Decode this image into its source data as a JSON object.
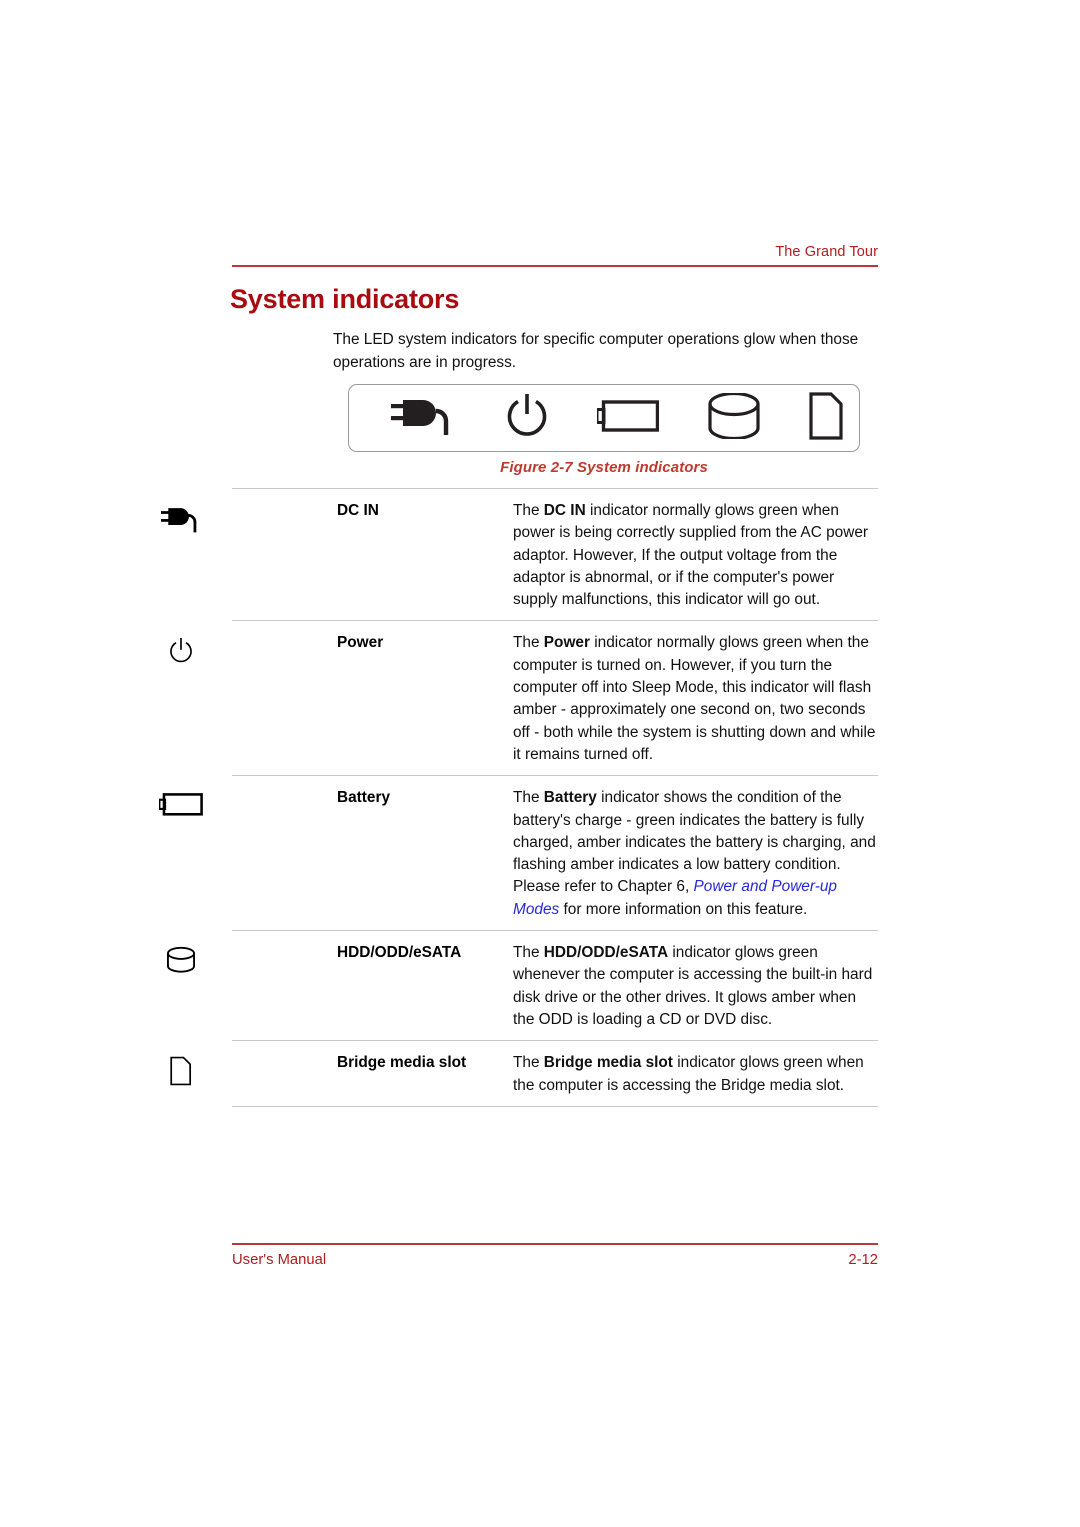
{
  "header": {
    "running_head": "The Grand Tour"
  },
  "section": {
    "title": "System indicators",
    "intro": "The LED system indicators for specific computer operations glow when those operations are in progress."
  },
  "figure": {
    "caption": "Figure 2-7 System indicators",
    "icons": [
      "dc-in-plug-icon",
      "power-button-icon",
      "battery-icon",
      "hdd-cylinder-icon",
      "bridge-media-card-icon"
    ]
  },
  "indicators": [
    {
      "icon": "dc-in-plug-icon",
      "name": "DC IN",
      "desc_prefix": "The ",
      "desc_bold": "DC IN",
      "desc_suffix": " indicator normally glows green when power is being correctly supplied from the AC power adaptor. However, If the output voltage from the adaptor is abnormal, or if the computer's power supply malfunctions, this indicator will go out."
    },
    {
      "icon": "power-button-icon",
      "name": "Power",
      "desc_prefix": "The ",
      "desc_bold": "Power",
      "desc_suffix": " indicator normally glows green when the computer is turned on. However, if you turn the computer off into Sleep Mode, this indicator will flash amber - approximately one second on, two seconds off - both while the system is shutting down and while it remains turned off."
    },
    {
      "icon": "battery-icon",
      "name": "Battery",
      "desc_prefix": "The ",
      "desc_bold": "Battery",
      "desc_mid": " indicator shows the condition of the battery's charge - green indicates the battery is fully charged, amber indicates the battery is charging, and flashing amber indicates a low battery condition. Please refer to Chapter 6, ",
      "desc_link": "Power and Power-up Modes",
      "desc_suffix": " for more information on this feature."
    },
    {
      "icon": "hdd-cylinder-icon",
      "name": "HDD/ODD/eSATA",
      "desc_prefix": "The ",
      "desc_bold": "HDD/ODD/eSATA",
      "desc_suffix": " indicator glows green whenever the computer is accessing the built-in hard disk drive or the other drives. It glows amber when the ODD is loading a CD or DVD disc."
    },
    {
      "icon": "bridge-media-card-icon",
      "name": "Bridge media slot",
      "desc_prefix": "The ",
      "desc_bold": "Bridge media slot",
      "desc_suffix": " indicator glows green when the computer is accessing the Bridge media slot."
    }
  ],
  "footer": {
    "left": "User's Manual",
    "right": "2-12"
  },
  "colors": {
    "accent_red": "#B01C20",
    "heading_red": "#A80C10",
    "caption_red": "#C0392F",
    "link_blue": "#2727DD",
    "rule_gray": "#c9c9c9"
  }
}
